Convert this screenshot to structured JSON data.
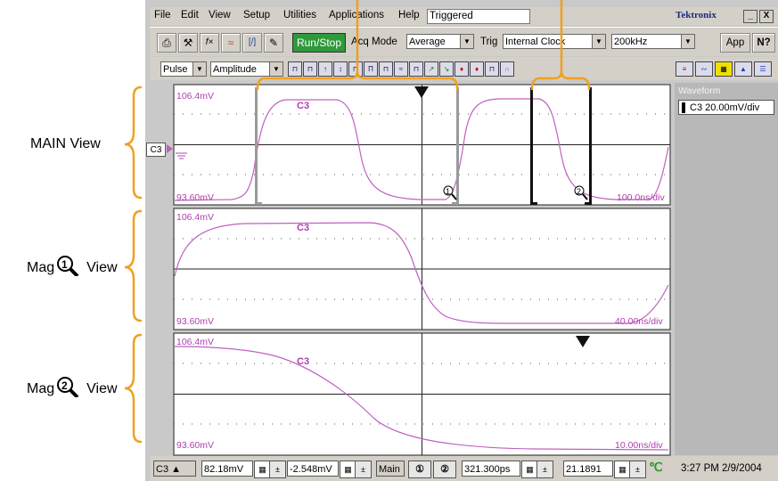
{
  "menubar": {
    "items": [
      "File",
      "Edit",
      "View",
      "Setup",
      "Utilities",
      "Applications",
      "Help"
    ],
    "status": "Triggered",
    "brand": "Tektronix",
    "minimize": "_",
    "close": "X"
  },
  "toolbar": {
    "run_stop": "Run/Stop",
    "acq_mode_label": "Acq Mode",
    "acq_mode_value": "Average",
    "trig_label": "Trig",
    "trig_value": "Internal Clock",
    "rate_value": "200kHz",
    "app_button": "App",
    "help_button": "N?"
  },
  "toolbar2": {
    "measure_category": "Pulse",
    "measure_type": "Amplitude"
  },
  "views": {
    "main": {
      "annotation": "MAIN View",
      "top_ref": "106.4mV",
      "bottom_ref": "93.60mV",
      "timebase": "100.0ns/div",
      "channel": "C3"
    },
    "mag1": {
      "annotation_prefix": "Mag",
      "annotation_suffix": "View",
      "top_ref": "106.4mV",
      "bottom_ref": "93.60mV",
      "timebase": "40.00ns/div",
      "channel": "C3"
    },
    "mag2": {
      "annotation_prefix": "Mag",
      "annotation_suffix": "View",
      "top_ref": "106.4mV",
      "bottom_ref": "93.60mV",
      "timebase": "10.00ns/div",
      "channel": "C3"
    }
  },
  "side_panel": {
    "title": "Waveform",
    "channel_scale": "C3 20.00mV/div"
  },
  "channel_marker": "C3",
  "status_bar": {
    "channel": "C3",
    "vertical_scale": "82.18mV",
    "vertical_offset": "-2.548mV",
    "view_select": "Main",
    "position": "321.300ps",
    "scale": "21.1891",
    "clock": "3:27 PM 2/9/2004"
  },
  "colors": {
    "waveform": "#c060c0",
    "bracket": "#f0a020",
    "accent_green": "#2e9a3a",
    "panel": "#c9c9c9"
  }
}
